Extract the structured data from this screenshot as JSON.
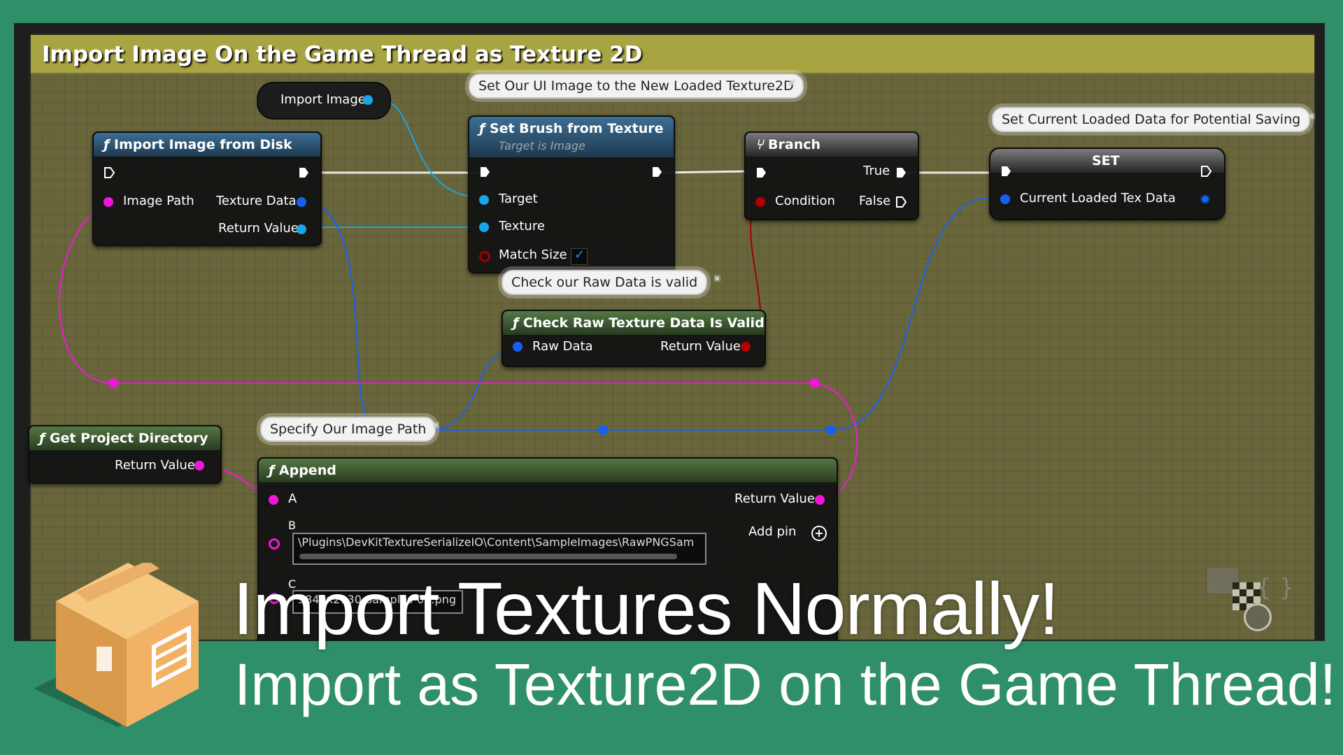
{
  "comment": {
    "title": "Import Image On the Game Thread as Texture 2D"
  },
  "variable_get": {
    "label": "Import Image"
  },
  "import_node": {
    "title": "Import Image from Disk",
    "pin_image_path": "Image Path",
    "pin_texture_data": "Texture Data",
    "pin_return": "Return Value"
  },
  "set_brush_node": {
    "comment": "Set Our UI Image to the New Loaded Texture2D",
    "title": "Set Brush from Texture",
    "subtitle": "Target is Image",
    "pin_target": "Target",
    "pin_texture": "Texture",
    "pin_match_size": "Match Size",
    "match_size_checked": true
  },
  "branch_node": {
    "title": "Branch",
    "pin_true": "True",
    "pin_condition": "Condition",
    "pin_false": "False"
  },
  "set_node": {
    "comment": "Set Current Loaded Data for Potential Saving",
    "title": "SET",
    "pin_var": "Current Loaded Tex Data"
  },
  "check_node": {
    "comment": "Check our Raw Data is valid",
    "title": "Check Raw Texture Data Is Valid",
    "pin_raw": "Raw Data",
    "pin_return": "Return Value"
  },
  "project_dir_node": {
    "title": "Get Project Directory",
    "pin_return": "Return Value"
  },
  "append_node": {
    "comment": "Specify Our Image Path",
    "title": "Append",
    "pin_a": "A",
    "pin_b": "B",
    "pin_c": "C",
    "pin_return": "Return Value",
    "add_pin": "Add pin",
    "b_value": "\\Plugins\\DevKitTextureSerializeIO\\Content\\SampleImages\\RawPNGSam",
    "c_value": "3840x2130 Samples-02.png"
  },
  "banner": {
    "title": "Import Textures Normally!",
    "subtitle": "Import as Texture2D on the Game Thread!"
  },
  "colors": {
    "background": "#2e8f68",
    "comment_header": "#a9a442",
    "object_pin": "#17a7e8",
    "string_pin": "#f018d8",
    "struct_pin": "#1861f0",
    "bool_pin": "#b10000"
  }
}
